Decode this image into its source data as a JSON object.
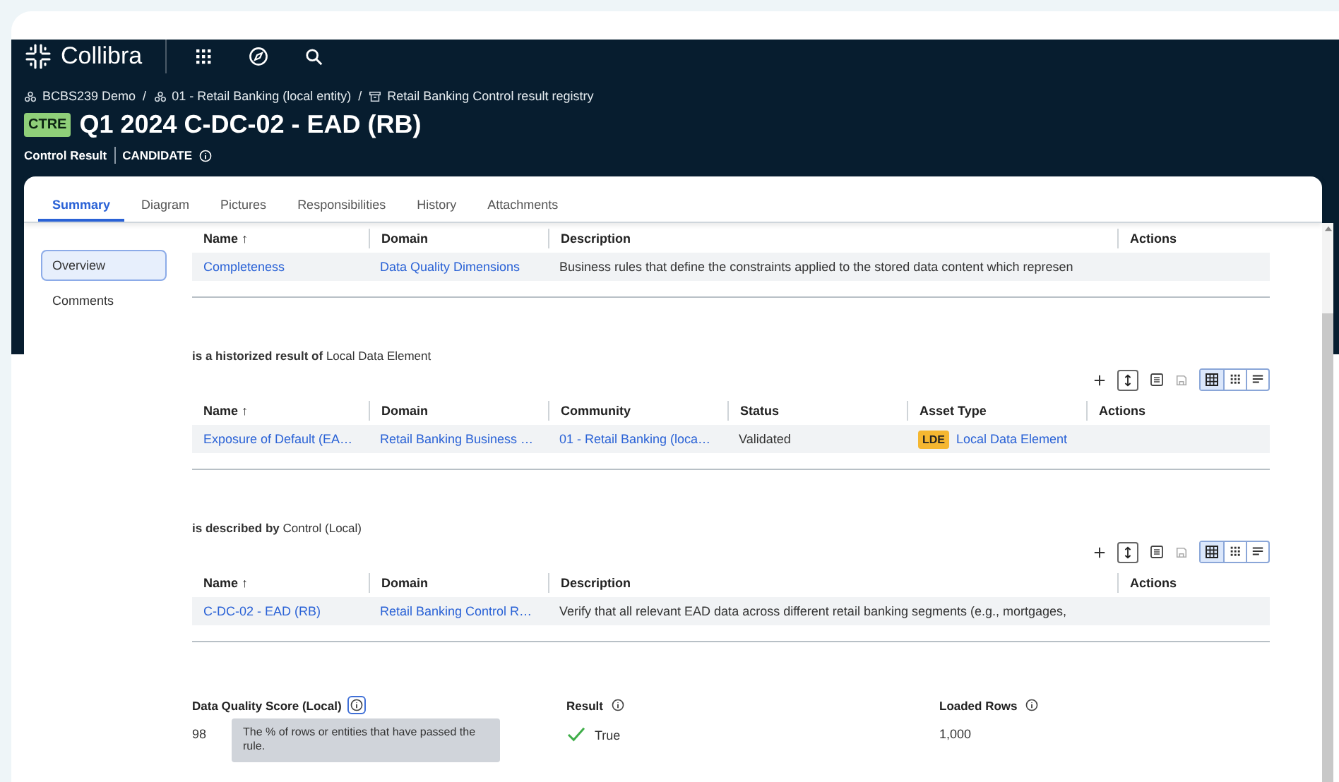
{
  "app": {
    "brand": "Collibra"
  },
  "breadcrumb_separator": "/",
  "breadcrumbs": [
    {
      "label": "BCBS239 Demo",
      "kind": "community"
    },
    {
      "label": "01 - Retail Banking (local entity)",
      "kind": "community"
    },
    {
      "label": "Retail Banking Control result registry",
      "kind": "domain"
    }
  ],
  "asset": {
    "badge": "CTRE",
    "title": "Q1 2024 C-DC-02 - EAD (RB)",
    "type": "Control Result",
    "status": "CANDIDATE"
  },
  "tabs": [
    {
      "label": "Summary",
      "selected": true
    },
    {
      "label": "Diagram",
      "selected": false
    },
    {
      "label": "Pictures",
      "selected": false
    },
    {
      "label": "Responsibilities",
      "selected": false
    },
    {
      "label": "History",
      "selected": false
    },
    {
      "label": "Attachments",
      "selected": false
    }
  ],
  "sidebar": {
    "items": [
      {
        "label": "Overview",
        "selected": true
      },
      {
        "label": "Comments",
        "selected": false
      }
    ]
  },
  "sections": [
    {
      "columns": [
        "Name ↑",
        "Domain",
        "Description",
        "Actions"
      ],
      "rows": [
        [
          {
            "text": "Completeness",
            "kind": "link"
          },
          {
            "text": "Data Quality Dimensions",
            "kind": "link"
          },
          {
            "text": "Business rules that define the constraints applied to the stored data content which represen",
            "kind": "text"
          },
          {
            "text": "",
            "kind": "empty"
          }
        ]
      ]
    },
    {
      "heading": "**is a historized result of** Local Data Element",
      "toolbar": true,
      "columns": [
        "Name ↑",
        "Domain",
        "Community",
        "Status",
        "Asset Type",
        "Actions"
      ],
      "rows": [
        [
          {
            "text": "Exposure of Default (EA…",
            "kind": "link"
          },
          {
            "text": "Retail Banking Business …",
            "kind": "link"
          },
          {
            "text": "01 - Retail Banking (loca…",
            "kind": "link"
          },
          {
            "text": "Validated",
            "kind": "text"
          },
          {
            "text": "Local Data Element",
            "kind": "link",
            "badge": "LDE"
          },
          {
            "text": "",
            "kind": "empty"
          }
        ]
      ]
    },
    {
      "heading": "**is described by** Control (Local)",
      "toolbar": true,
      "columns": [
        "Name ↑",
        "Domain",
        "Description",
        "Actions"
      ],
      "rows": [
        [
          {
            "text": "C-DC-02 - EAD (RB)",
            "kind": "link"
          },
          {
            "text": "Retail Banking Control R…",
            "kind": "link"
          },
          {
            "text": "Verify that all relevant EAD data across different retail banking segments (e.g., mortgages,",
            "kind": "text"
          },
          {
            "text": "",
            "kind": "empty"
          }
        ]
      ]
    }
  ],
  "attributes": [
    {
      "label": "Data Quality Score (Local)",
      "value": "98",
      "kind": "text",
      "info_active": true
    },
    {
      "label": "Result",
      "value": "True",
      "kind": "check",
      "info_active": false
    },
    {
      "label": "Loaded Rows",
      "value": "1,000",
      "kind": "text",
      "info_active": false
    }
  ],
  "tooltip": "The % of rows or entities that have passed the rule."
}
